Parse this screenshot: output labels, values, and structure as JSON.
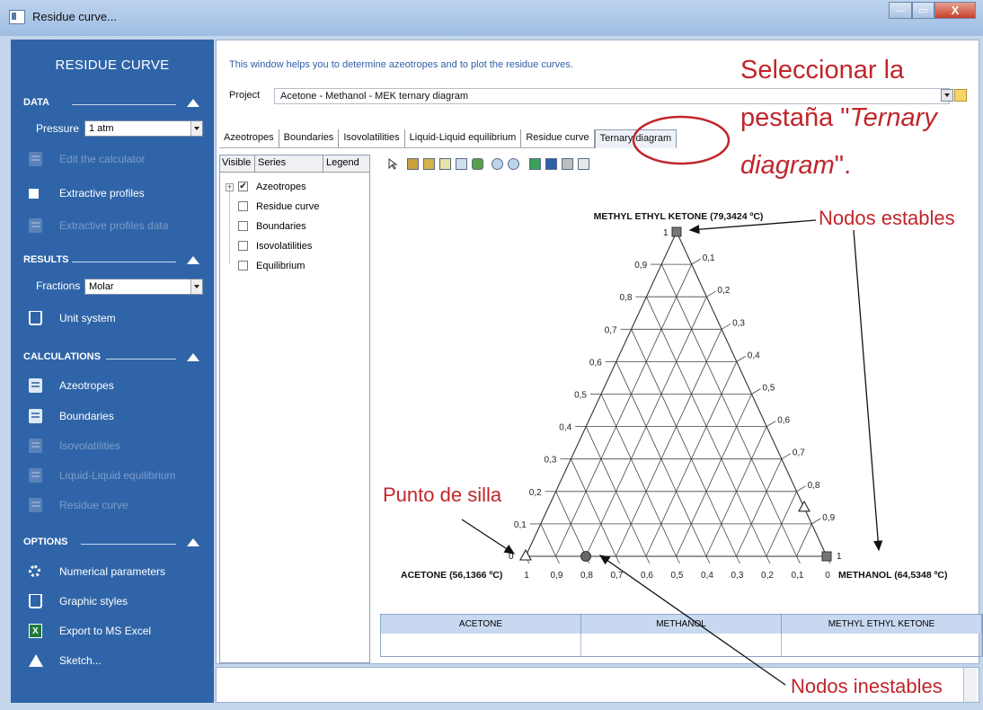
{
  "window": {
    "title": "Residue curve...",
    "close_glyph": "X"
  },
  "sidebar": {
    "title": "RESIDUE CURVE",
    "data_section": "DATA",
    "pressure_label": "Pressure",
    "pressure_value": "1 atm",
    "edit_calculator": "Edit the calculator",
    "extractive_profiles": "Extractive profiles",
    "extractive_profiles_data": "Extractive profiles data",
    "results_section": "RESULTS",
    "fractions_label": "Fractions",
    "fractions_value": "Molar",
    "unit_system": "Unit system",
    "calculations_section": "CALCULATIONS",
    "calc_items": [
      "Azeotropes",
      "Boundaries",
      "Isovolatilities",
      "Liquid-Liquid equilibrium",
      "Residue curve"
    ],
    "options_section": "OPTIONS",
    "option_items": [
      "Numerical parameters",
      "Graphic styles",
      "Export to MS Excel",
      "Sketch..."
    ]
  },
  "main": {
    "help_text": "This window helps you to determine azeotropes and to plot the residue curves.",
    "project_label": "Project",
    "project_value": "Acetone - Methanol - MEK ternary diagram",
    "tabs": [
      "Azeotropes",
      "Boundaries",
      "Isovolatilities",
      "Liquid-Liquid equilibrium",
      "Residue curve",
      "Ternary diagram"
    ],
    "selected_tab": "Ternary diagram"
  },
  "series_panel": {
    "headers": [
      "Visible",
      "Series",
      "Legend"
    ],
    "expander": "+",
    "check_mark": "✔",
    "rows": [
      {
        "label": "Azeotropes",
        "checked": true
      },
      {
        "label": "Residue curve",
        "checked": false
      },
      {
        "label": "Boundaries",
        "checked": false
      },
      {
        "label": "Isovolatilities",
        "checked": false
      },
      {
        "label": "Equilibrium",
        "checked": false
      }
    ]
  },
  "diagram": {
    "top_label": "METHYL ETHYL KETONE (79,3424 ºC)",
    "left_label": "ACETONE (56,1366 ºC)",
    "right_label": "METHANOL (64,5348 ºC)",
    "top_vertex_value": "1",
    "left_vertex_value": "0",
    "right_vertex_value": "1",
    "left_ticks": [
      "0,9",
      "0,8",
      "0,7",
      "0,6",
      "0,5",
      "0,4",
      "0,3",
      "0,2",
      "0,1"
    ],
    "right_ticks": [
      "0,1",
      "0,2",
      "0,3",
      "0,4",
      "0,5",
      "0,6",
      "0,7",
      "0,8",
      "0,9"
    ],
    "bottom_ticks": [
      "1",
      "0,9",
      "0,8",
      "0,7",
      "0,6",
      "0,5",
      "0,4",
      "0,3",
      "0,2",
      "0,1",
      "0"
    ],
    "points": [
      {
        "name": "MEK vertex",
        "marker": "square",
        "acetone": 0,
        "methanol": 0,
        "mek": 1
      },
      {
        "name": "Methanol vertex",
        "marker": "square",
        "acetone": 0,
        "methanol": 1,
        "mek": 0
      },
      {
        "name": "Acetone vertex",
        "marker": "triangle",
        "acetone": 1,
        "methanol": 0,
        "mek": 0
      },
      {
        "name": "Binary azeotrope acetone-methanol",
        "marker": "circle",
        "acetone": 0.8,
        "methanol": 0.2,
        "mek": 0
      },
      {
        "name": "Binary azeotrope methanol-MEK",
        "marker": "triangle",
        "acetone": 0,
        "methanol": 0.85,
        "mek": 0.15
      }
    ]
  },
  "table": {
    "headers": [
      "ACETONE",
      "METHANOL",
      "METHYL ETHYL KETONE"
    ]
  },
  "annotations": {
    "select_tab_1": "Seleccionar la",
    "select_tab_2a": "pestaña \"",
    "select_tab_2b": "Ternary",
    "select_tab_3a": "diagram",
    "select_tab_3b": "\".",
    "stable_nodes": "Nodos estables",
    "saddle_point": "Punto de silla",
    "unstable_nodes": "Nodos inestables"
  },
  "colors": {
    "sidebar": "#2f65a8",
    "annotation": "#c0262b",
    "help_text": "#2f5fa6"
  }
}
